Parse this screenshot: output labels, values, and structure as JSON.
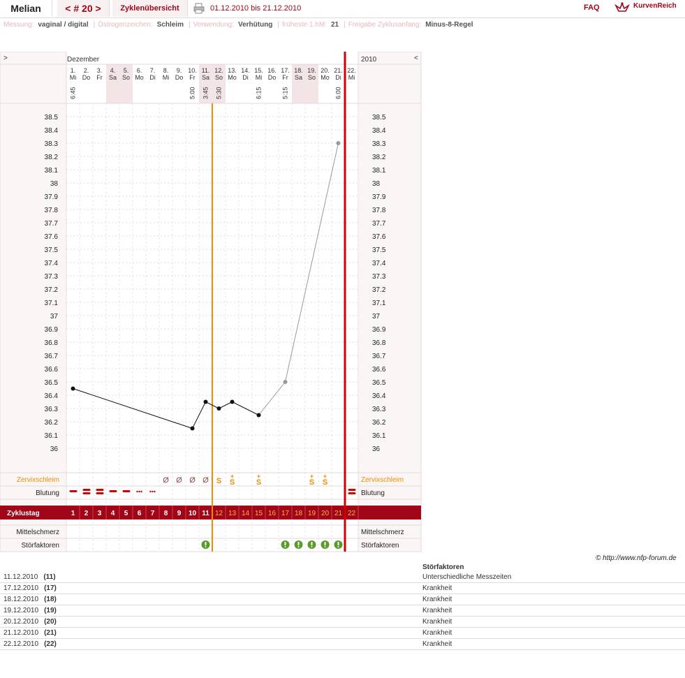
{
  "header": {
    "user": "Melian",
    "cycle_nav": "< # 20 >",
    "overview_tab": "Zyklenübersicht",
    "date_range": "01.12.2010 bis 21.12.2010",
    "faq": "FAQ",
    "logo_text": "KurvenReich"
  },
  "info": [
    {
      "label": "Messung:",
      "value": "vaginal / digital"
    },
    {
      "label": "Östrogenzeichen:",
      "value": "Schleim"
    },
    {
      "label": "Verwendung:",
      "value": "Verhütung"
    },
    {
      "label": "früheste 1.hM:",
      "value": "21"
    },
    {
      "label": "Freigabe Zyklusanfang:",
      "value": "Minus-8-Regel"
    }
  ],
  "chart_data": {
    "type": "line",
    "month": "Dezember",
    "year": "2010",
    "nav_left": ">",
    "nav_right": "<",
    "days": [
      {
        "num": "1.",
        "wd": "Mi",
        "time": "6:45",
        "weekend": false
      },
      {
        "num": "2.",
        "wd": "Do",
        "time": "",
        "weekend": false
      },
      {
        "num": "3.",
        "wd": "Fr",
        "time": "",
        "weekend": false
      },
      {
        "num": "4.",
        "wd": "Sa",
        "time": "",
        "weekend": true
      },
      {
        "num": "5.",
        "wd": "So",
        "time": "",
        "weekend": true
      },
      {
        "num": "6.",
        "wd": "Mo",
        "time": "",
        "weekend": false
      },
      {
        "num": "7.",
        "wd": "Di",
        "time": "",
        "weekend": false
      },
      {
        "num": "8.",
        "wd": "Mi",
        "time": "",
        "weekend": false
      },
      {
        "num": "9.",
        "wd": "Do",
        "time": "",
        "weekend": false
      },
      {
        "num": "10.",
        "wd": "Fr",
        "time": "5:00",
        "weekend": false
      },
      {
        "num": "11.",
        "wd": "Sa",
        "time": "3:45",
        "weekend": true
      },
      {
        "num": "12.",
        "wd": "So",
        "time": "5:30",
        "weekend": true
      },
      {
        "num": "13.",
        "wd": "Mo",
        "time": "",
        "weekend": false
      },
      {
        "num": "14.",
        "wd": "Di",
        "time": "",
        "weekend": false
      },
      {
        "num": "15.",
        "wd": "Mi",
        "time": "6:15",
        "weekend": false
      },
      {
        "num": "16.",
        "wd": "Do",
        "time": "",
        "weekend": false
      },
      {
        "num": "17.",
        "wd": "Fr",
        "time": "5:15",
        "weekend": false
      },
      {
        "num": "18.",
        "wd": "Sa",
        "time": "",
        "weekend": true
      },
      {
        "num": "19.",
        "wd": "So",
        "time": "",
        "weekend": true
      },
      {
        "num": "20.",
        "wd": "Mo",
        "time": "",
        "weekend": false
      },
      {
        "num": "21.",
        "wd": "Di",
        "time": "6:00",
        "weekend": false
      },
      {
        "num": "22.",
        "wd": "Mi",
        "time": "",
        "weekend": false
      }
    ],
    "y_ticks": [
      "38.5",
      "38.4",
      "38.3",
      "38.2",
      "38.1",
      "38",
      "37.9",
      "37.8",
      "37.7",
      "37.6",
      "37.5",
      "37.4",
      "37.3",
      "37.2",
      "37.1",
      "37",
      "36.9",
      "36.8",
      "36.7",
      "36.6",
      "36.5",
      "36.4",
      "36.3",
      "36.2",
      "36.1",
      "36"
    ],
    "ylim": [
      36.0,
      38.5
    ],
    "temperatures": [
      {
        "day": 1,
        "value": 36.45,
        "disturbed": false
      },
      {
        "day": 10,
        "value": 36.15,
        "disturbed": false
      },
      {
        "day": 11,
        "value": 36.35,
        "disturbed": false
      },
      {
        "day": 12,
        "value": 36.3,
        "disturbed": false
      },
      {
        "day": 13,
        "value": 36.35,
        "disturbed": false
      },
      {
        "day": 15,
        "value": 36.25,
        "disturbed": false
      },
      {
        "day": 17,
        "value": 36.5,
        "disturbed": true
      },
      {
        "day": 21,
        "value": 38.3,
        "disturbed": true
      }
    ],
    "marker_orange_after_day": 11,
    "marker_red_after_day": 21,
    "row_labels": {
      "zervix": "Zervixschleim",
      "blutung": "Blutung",
      "zyklustag": "Zyklustag",
      "mittelschmerz": "Mittelschmerz",
      "stoerfaktoren": "Störfaktoren"
    },
    "zervix": {
      "8": "Ø",
      "9": "Ø",
      "10": "Ø",
      "11": "Ø",
      "12": "S",
      "13": "S+",
      "15": "S+",
      "19": "S+",
      "20": "S+"
    },
    "blutung": {
      "1": "medium",
      "2": "heavy",
      "3": "heavy",
      "4": "medium",
      "5": "medium",
      "6": "spot",
      "7": "spot",
      "22": "heavy"
    },
    "stoerfaktoren_days": [
      11,
      17,
      18,
      19,
      20,
      21
    ],
    "cycle_days": [
      "1",
      "2",
      "3",
      "4",
      "5",
      "6",
      "7",
      "8",
      "9",
      "10",
      "11",
      "12",
      "13",
      "14",
      "15",
      "16",
      "17",
      "18",
      "19",
      "20",
      "21",
      "22"
    ],
    "colors": {
      "brand": "#a00518",
      "orange": "#f08c00",
      "red": "#d40000",
      "green": "#5a9a2a",
      "weekend": "#f3e4e6"
    }
  },
  "copyright": "© http://www.nfp-forum.de",
  "notes": {
    "header": "Störfaktoren",
    "rows": [
      {
        "date": "11.12.2010",
        "day": "(11)",
        "text": "Unterschiedliche Messzeiten"
      },
      {
        "date": "17.12.2010",
        "day": "(17)",
        "text": "Krankheit"
      },
      {
        "date": "18.12.2010",
        "day": "(18)",
        "text": "Krankheit"
      },
      {
        "date": "19.12.2010",
        "day": "(19)",
        "text": "Krankheit"
      },
      {
        "date": "20.12.2010",
        "day": "(20)",
        "text": "Krankheit"
      },
      {
        "date": "21.12.2010",
        "day": "(21)",
        "text": "Krankheit"
      },
      {
        "date": "22.12.2010",
        "day": "(22)",
        "text": "Krankheit"
      }
    ]
  }
}
